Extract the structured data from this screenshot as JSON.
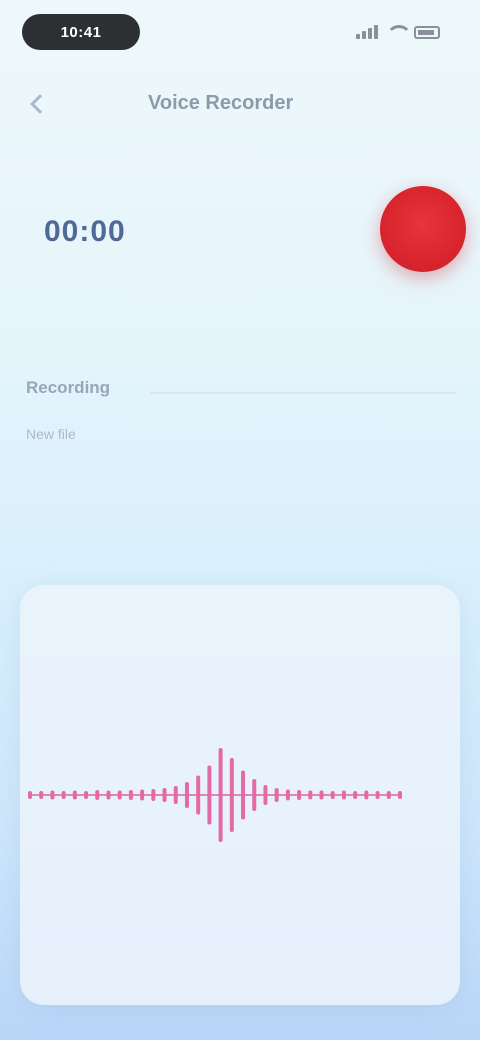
{
  "status_bar": {
    "time": "10:41",
    "icons": [
      "signal-icon",
      "wifi-icon",
      "battery-icon"
    ]
  },
  "header": {
    "title": "Voice Recorder",
    "back_icon": "chevron-left-icon"
  },
  "recorder": {
    "timer": "00:00",
    "record_color": "#d9252d",
    "record_icon": "record-icon"
  },
  "info": {
    "label": "Recording",
    "sub": "New file"
  },
  "waveform": {
    "color": "#e46aa6",
    "levels": [
      0.04,
      0.04,
      0.05,
      0.04,
      0.05,
      0.04,
      0.06,
      0.05,
      0.05,
      0.06,
      0.07,
      0.08,
      0.1,
      0.14,
      0.22,
      0.35,
      0.55,
      0.9,
      0.7,
      0.45,
      0.28,
      0.16,
      0.1,
      0.07,
      0.06,
      0.05,
      0.05,
      0.04,
      0.05,
      0.04,
      0.05,
      0.04,
      0.04,
      0.04
    ]
  }
}
